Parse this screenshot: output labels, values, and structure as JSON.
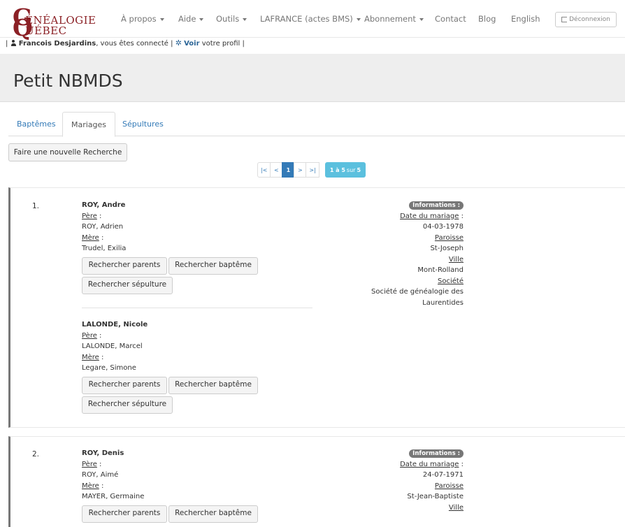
{
  "brand": {
    "line1_big": "G",
    "line1_rest": "ÉNÉALOGIE",
    "line2_big": "Q",
    "line2_rest": "UÉBEC",
    "color": "#8b2025"
  },
  "nav": {
    "items": [
      {
        "label": "À propos",
        "dropdown": true
      },
      {
        "label": "Aide",
        "dropdown": true
      },
      {
        "label": "Outils",
        "dropdown": true
      },
      {
        "label": "LAFRANCE (actes BMS)",
        "dropdown": true
      },
      {
        "label": "Abonnement",
        "dropdown": true
      },
      {
        "label": "Contact",
        "dropdown": false
      },
      {
        "label": "Blog",
        "dropdown": false
      },
      {
        "label": "English",
        "dropdown": false
      }
    ],
    "logout_label": "Déconnexion"
  },
  "userbar": {
    "sep_left": "|",
    "user_name": "Francois Desjardins",
    "connected_text": ", vous êtes connecté |",
    "profile_link": "Voir",
    "profile_text": "votre profil |"
  },
  "page_title": "Petit NBMDS",
  "tabs": [
    {
      "label": "Baptêmes",
      "active": false
    },
    {
      "label": "Mariages",
      "active": true
    },
    {
      "label": "Sépultures",
      "active": false
    }
  ],
  "new_search_label": "Faire une nouvelle Recherche",
  "pagination": {
    "first": "|<",
    "prev": "<",
    "current": "1",
    "next": ">",
    "last": ">|",
    "info_range": "1 à 5",
    "info_sur": "sur",
    "info_total": "5"
  },
  "labels": {
    "father": "Père",
    "mother": "Mère",
    "colon": " :",
    "btn_parents": "Rechercher parents",
    "btn_baptism": "Rechercher baptême",
    "btn_burial": "Rechercher sépulture",
    "info_badge": "Informations :",
    "marriage_date": "Date du mariage",
    "parish": "Paroisse",
    "city": "Ville",
    "society": "Société"
  },
  "records": [
    {
      "number": "1.",
      "spouse1": {
        "name": "ROY, Andre",
        "father": "ROY, Adrien",
        "mother": "Trudel, Exilia"
      },
      "spouse2": {
        "name": "LALONDE, Nicole",
        "father": "LALONDE, Marcel",
        "mother": "Legare, Simone"
      },
      "info": {
        "date": "04-03-1978",
        "parish": "St-Joseph",
        "city": "Mont-Rolland",
        "society_line1": "Société de généalogie des",
        "society_line2": "Laurentides"
      }
    },
    {
      "number": "2.",
      "spouse1": {
        "name": "ROY, Denis",
        "father": "ROY, Aimé",
        "mother": "MAYER, Germaine"
      },
      "info": {
        "date": "24-07-1971",
        "parish": "St-Jean-Baptiste"
      }
    }
  ]
}
